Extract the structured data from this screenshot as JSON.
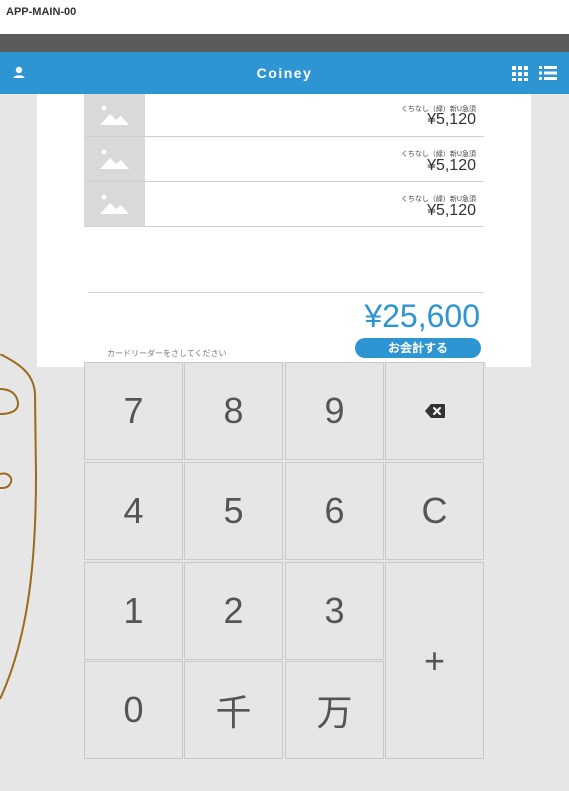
{
  "screen_id": "APP-MAIN-00",
  "app": {
    "title": "Coiney",
    "accent_color": "#2e95d3"
  },
  "order": {
    "items": [
      {
        "thumbnail_icon": "image-placeholder-icon",
        "description": "くちなし（緑）新U急須",
        "price": "¥5,120"
      },
      {
        "thumbnail_icon": "image-placeholder-icon",
        "description": "くちなし（緑）新U急須",
        "price": "¥5,120"
      },
      {
        "thumbnail_icon": "image-placeholder-icon",
        "description": "くちなし（緑）新U急須",
        "price": "¥5,120"
      }
    ],
    "reader_prompt": "カードリーダーをさしてください",
    "total": "¥25,600",
    "checkout_label": "お会計する"
  },
  "keypad": {
    "keys": [
      "7",
      "8",
      "9",
      "4",
      "5",
      "6",
      "C",
      "1",
      "2",
      "3",
      "+",
      "0",
      "千",
      "万"
    ],
    "backspace_icon": "backspace-icon"
  },
  "icons": {
    "user": "user-icon",
    "grid": "grid-icon",
    "list": "list-icon"
  }
}
